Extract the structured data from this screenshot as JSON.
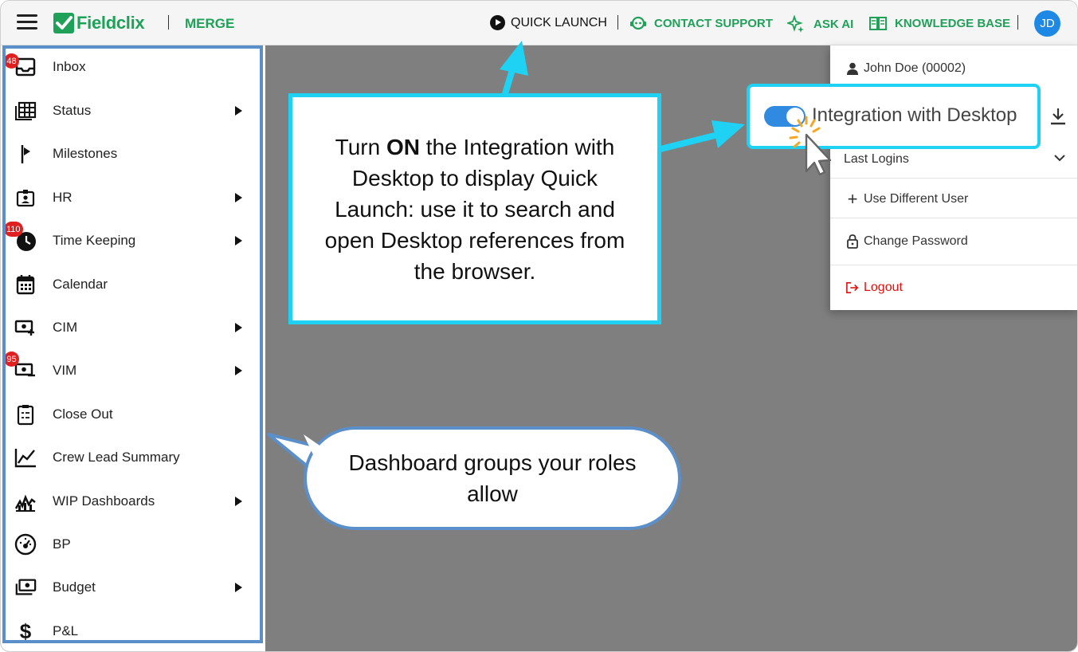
{
  "header": {
    "brand": "Fieldclix",
    "module": "MERGE",
    "quick_launch": "QUICK LAUNCH",
    "contact_support": "CONTACT SUPPORT",
    "ask_ai": "ASK AI",
    "knowledge_base": "KNOWLEDGE BASE",
    "avatar_initials": "JD",
    "brand_color": "#20a15a",
    "avatar_color": "#1e88e5"
  },
  "sidebar": {
    "items": [
      {
        "label": "Inbox",
        "icon": "inbox-icon",
        "badge": "48",
        "submenu": false
      },
      {
        "label": "Status",
        "icon": "table-icon",
        "badge": "",
        "submenu": true
      },
      {
        "label": "Milestones",
        "icon": "flag-icon",
        "badge": "",
        "submenu": false
      },
      {
        "label": "HR",
        "icon": "id-badge-icon",
        "badge": "",
        "submenu": true
      },
      {
        "label": "Time Keeping",
        "icon": "clock-icon",
        "badge": "110",
        "submenu": true
      },
      {
        "label": "Calendar",
        "icon": "calendar-icon",
        "badge": "",
        "submenu": false
      },
      {
        "label": "CIM",
        "icon": "money-plus-icon",
        "badge": "",
        "submenu": true
      },
      {
        "label": "VIM",
        "icon": "money-minus-icon",
        "badge": "95",
        "submenu": true
      },
      {
        "label": "Close Out",
        "icon": "clipboard-list-icon",
        "badge": "",
        "submenu": false
      },
      {
        "label": "Crew Lead Summary",
        "icon": "line-chart-icon",
        "badge": "",
        "submenu": false
      },
      {
        "label": "WIP Dashboards",
        "icon": "trend-chart-icon",
        "badge": "",
        "submenu": true
      },
      {
        "label": "BP",
        "icon": "gauge-icon",
        "badge": "",
        "submenu": false
      },
      {
        "label": "Budget",
        "icon": "cash-stack-icon",
        "badge": "",
        "submenu": true
      },
      {
        "label": "P&L",
        "icon": "dollar-icon",
        "badge": "",
        "submenu": false
      }
    ]
  },
  "user_menu": {
    "user_name": "John Doe (00002)",
    "integration_label": "Integration with Desktop",
    "integration_on": true,
    "last_logins": "Last Logins",
    "use_different_user": "Use Different User",
    "change_password": "Change Password",
    "logout": "Logout",
    "logout_color": "#e01010"
  },
  "callouts": {
    "integration_pre": "Turn ",
    "integration_bold": "ON",
    "integration_post": " the Integration with Desktop to display Quick Launch: use it to search and open Desktop references from the browser.",
    "dashboard": "Dashboard groups your roles allow",
    "highlight_color": "#1fd1f2",
    "outline_color": "#5b8fca"
  }
}
